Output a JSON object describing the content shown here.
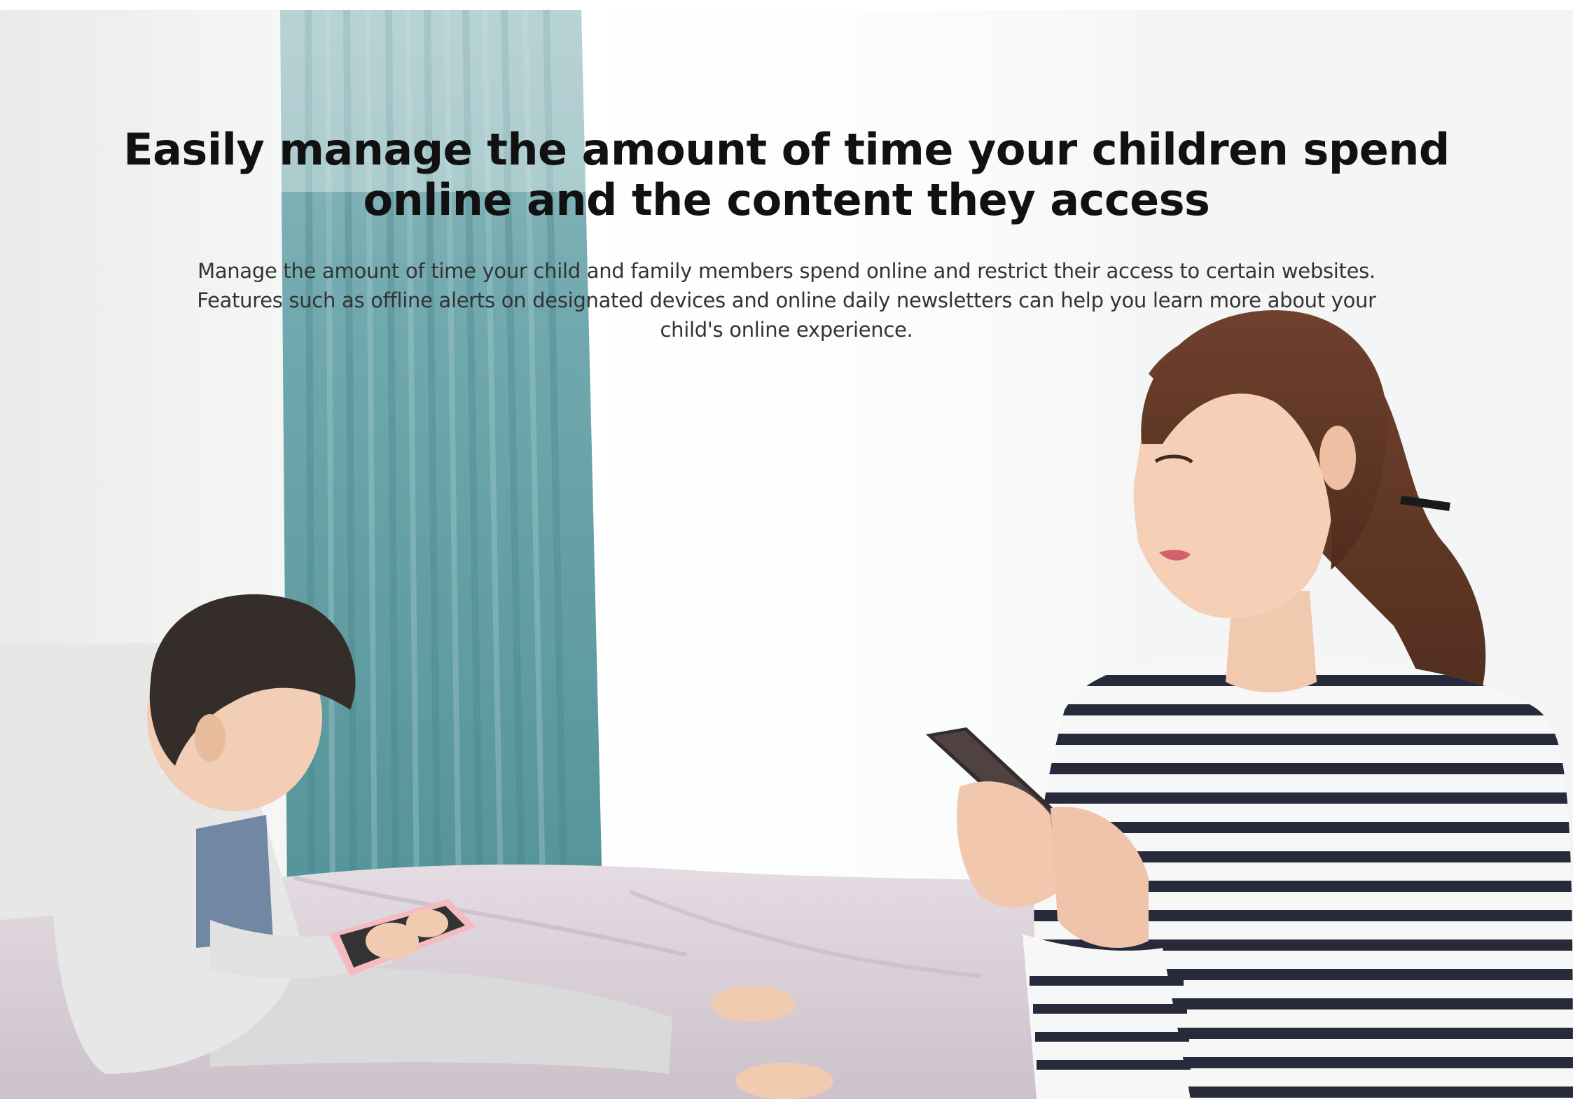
{
  "hero": {
    "headline": "Easily manage the amount of time your children spend online and the content they access",
    "subcopy": "Manage the amount of time your child and family members spend online and restrict their access to certain websites. Features such as offline alerts on designated devices and online daily newsletters can help you learn more about your child's online experience."
  },
  "colors": {
    "text_primary": "#111111",
    "text_secondary": "#333333",
    "curtain": "#5f9ea3",
    "bedding": "#d8cdd6"
  }
}
